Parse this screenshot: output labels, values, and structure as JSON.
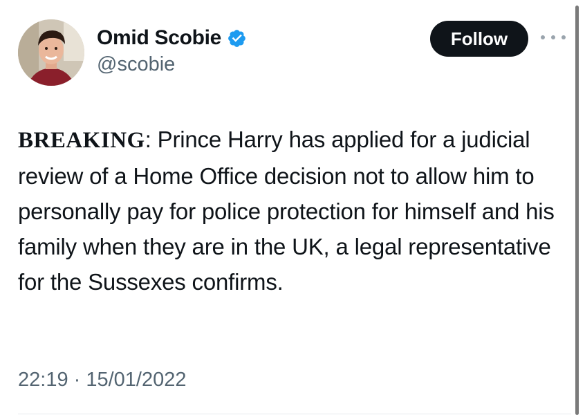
{
  "author": {
    "display_name": "Omid Scobie",
    "handle": "@scobie",
    "verified_icon": "verified-badge-icon",
    "verified_color": "#1d9bf0"
  },
  "actions": {
    "follow_label": "Follow",
    "more_icon": "more-horizontal-icon"
  },
  "tweet": {
    "lead": "BREAKING",
    "lead_suffix": ":",
    "body": " Prince Harry has applied for a judicial review of a Home Office decision not to allow him to personally pay for police protection for himself and his family when they are in the UK, a legal representative for the Sussexes confirms.",
    "timestamp": "22:19 · 15/01/2022"
  },
  "colors": {
    "text_primary": "#0f1419",
    "text_secondary": "#536471",
    "follow_bg": "#0f1419",
    "follow_text": "#ffffff"
  }
}
